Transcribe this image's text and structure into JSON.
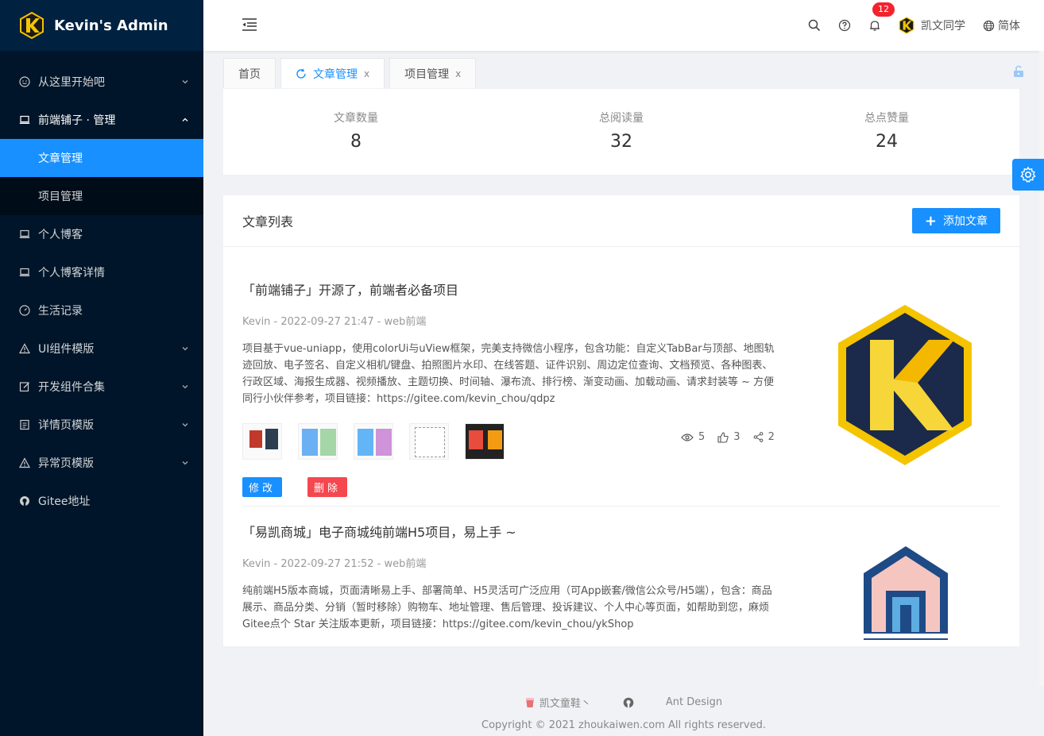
{
  "brand": {
    "title": "Kevin's Admin"
  },
  "sidebar": {
    "items": [
      {
        "label": "从这里开始吧",
        "icon": "smile-icon",
        "has_chevron": true
      },
      {
        "label": "前端铺子 · 管理",
        "icon": "laptop-icon",
        "open": true
      },
      {
        "label": "个人博客",
        "icon": "laptop-icon"
      },
      {
        "label": "个人博客详情",
        "icon": "laptop-icon"
      },
      {
        "label": "生活记录",
        "icon": "dashboard-icon"
      },
      {
        "label": "UI组件模版",
        "icon": "warning-icon",
        "has_chevron": true
      },
      {
        "label": "开发组件合集",
        "icon": "edit-icon",
        "has_chevron": true
      },
      {
        "label": "详情页模版",
        "icon": "profile-icon",
        "has_chevron": true
      },
      {
        "label": "异常页模版",
        "icon": "warning-icon",
        "has_chevron": true
      },
      {
        "label": "Gitee地址",
        "icon": "github-icon"
      }
    ],
    "submenu": [
      {
        "label": "文章管理",
        "active": true
      },
      {
        "label": "项目管理"
      }
    ]
  },
  "header": {
    "notification_count": "12",
    "user_name": "凯文同学",
    "language": "简体"
  },
  "tabs": [
    {
      "label": "首页"
    },
    {
      "label": "文章管理",
      "active": true,
      "close": "x"
    },
    {
      "label": "项目管理",
      "close": "x"
    }
  ],
  "stats": [
    {
      "label": "文章数量",
      "value": "8"
    },
    {
      "label": "总阅读量",
      "value": "32"
    },
    {
      "label": "总点赞量",
      "value": "24"
    }
  ],
  "article_list": {
    "title": "文章列表",
    "add_button": "添加文章",
    "articles": [
      {
        "title": "「前端铺子」开源了，前端者必备项目",
        "meta": "Kevin - 2022-09-27 21:47 - web前端",
        "desc": "项目基于vue-uniapp，使用colorUi与uView框架，完美支持微信小程序，包含功能：自定义TabBar与顶部、地图轨迹回放、电子签名、自定义相机/键盘、拍照图片水印、在线答题、证件识别、周边定位查询、文档预览、各种图表、行政区域、海报生成器、视频播放、主题切换、时间轴、瀑布流、排行榜、渐变动画、加载动画、请求封装等 ~ 方便同行小伙伴参考，项目链接：https://gitee.com/kevin_chou/qdpz",
        "views": "5",
        "likes": "3",
        "shares": "2",
        "edit_label": "修改",
        "delete_label": "删除"
      },
      {
        "title": "「易凯商城」电子商城纯前端H5项目，易上手 ~",
        "meta": "Kevin - 2022-09-27 21:52 - web前端",
        "desc": "纯前端H5版本商城，页面清晰易上手、部署简单、H5灵活可广泛应用（可App嵌套/微信公众号/H5端），包含：商品展示、商品分类、分销（暂时移除）购物车、地址管理、售后管理、投诉建议、个人中心等页面，如帮助到您，麻烦Gitee点个 Star 关注版本更新，项目链接：https://gitee.com/kevin_chou/ykShop"
      }
    ]
  },
  "footer": {
    "link1": "凯文童鞋丶",
    "link3": "Ant Design",
    "copyright": "Copyright © 2021 zhoukaiwen.com All rights reserved."
  },
  "colors": {
    "primary": "#1890ff",
    "sidebar_bg": "#001529",
    "danger": "#f5474f"
  }
}
